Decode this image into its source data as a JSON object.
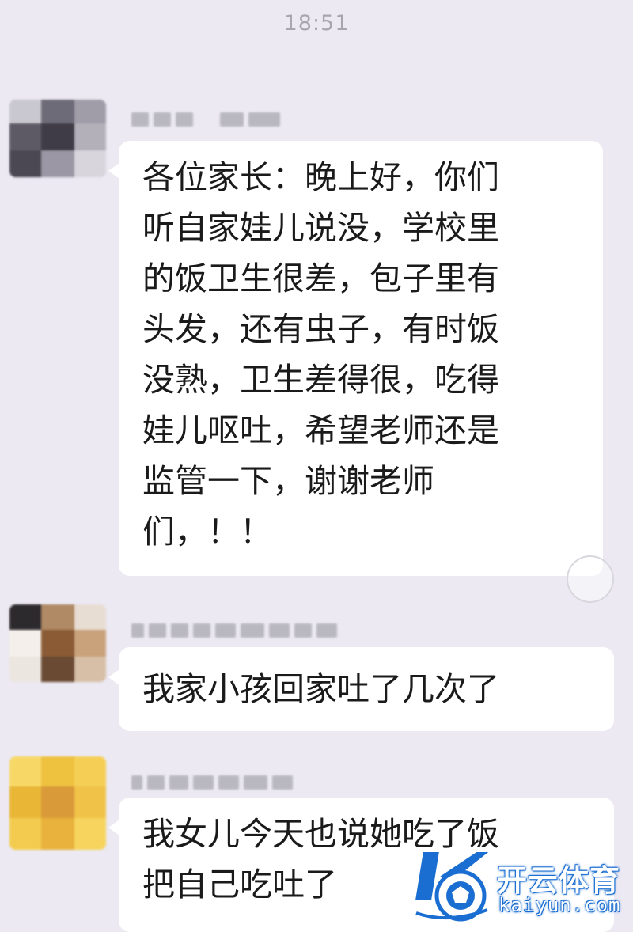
{
  "status": {
    "time": "18:51"
  },
  "messages": [
    {
      "text": "各位家长：晚上好，你们\n听自家娃儿说没，学校里\n的饭卫生很差，包子里有\n头发，还有虫子，有时饭\n没熟，卫生差得很，吃得\n娃儿呕吐，希望老师还是\n监管一下，谢谢老师\n们，！！",
      "avatar": "blurred-avatar",
      "sender": "blurred-name"
    },
    {
      "text": "我家小孩回家吐了几次了",
      "avatar": "blurred-avatar",
      "sender": "blurred-name"
    },
    {
      "text": "我女儿今天也说她吃了饭\n把自己吃吐了",
      "avatar": "blurred-avatar",
      "sender": "blurred-name"
    }
  ],
  "watermark": {
    "name_cn": "开云体育",
    "domain": "kaiyun.com"
  },
  "colors": {
    "background": "#ece9f2",
    "bubble": "#ffffff",
    "text": "#1a1a1a",
    "timestamp": "#a8a6ad",
    "watermark_blue": "#1b6ed1"
  },
  "icons": {
    "reply_indicator": "circle-icon",
    "watermark_logo": "kaiyun-logo-icon"
  }
}
